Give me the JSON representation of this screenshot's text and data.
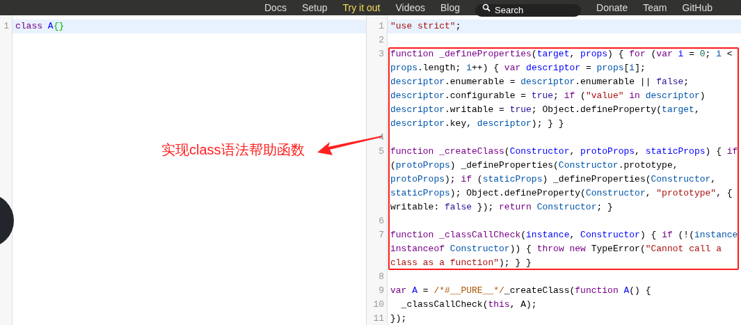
{
  "nav": {
    "items": [
      {
        "label": "Docs",
        "selected": false
      },
      {
        "label": "Setup",
        "selected": false
      },
      {
        "label": "Try it out",
        "selected": true
      },
      {
        "label": "Videos",
        "selected": false
      },
      {
        "label": "Blog",
        "selected": false
      }
    ],
    "search": {
      "placeholder": "Search"
    },
    "items_right": [
      {
        "label": "Donate",
        "selected": false
      },
      {
        "label": "Team",
        "selected": false
      },
      {
        "label": "GitHub",
        "selected": false
      }
    ]
  },
  "input_editor": {
    "lines": [
      {
        "number": "1",
        "selected": true,
        "tokens": [
          {
            "kind": "kw",
            "text": "class "
          },
          {
            "kind": "def",
            "text": "A"
          },
          {
            "kind": "br",
            "text": "{}"
          }
        ]
      }
    ]
  },
  "output_editor": {
    "lines_before": [
      {
        "number": "1",
        "selected": true,
        "tokens": [
          {
            "kind": "str",
            "text": "\"use strict\""
          },
          {
            "kind": "p",
            "text": ";"
          }
        ]
      },
      {
        "number": "2",
        "selected": false
      }
    ],
    "highlight_box": {
      "lines": [
        {
          "number": "3",
          "selected": false,
          "tokens": [
            {
              "kind": "kw",
              "text": "function _defineProperties"
            },
            {
              "kind": "p",
              "text": "("
            },
            {
              "kind": "def",
              "text": "target"
            },
            {
              "kind": "p",
              "text": ", "
            },
            {
              "kind": "def",
              "text": "props"
            },
            {
              "kind": "p",
              "text": ") { "
            },
            {
              "kind": "kw",
              "text": "for"
            },
            {
              "kind": "p",
              "text": " ("
            },
            {
              "kind": "kw",
              "text": "var "
            },
            {
              "kind": "def",
              "text": "i"
            },
            {
              "kind": "p",
              "text": " = "
            },
            {
              "kind": "num",
              "text": "0"
            },
            {
              "kind": "p",
              "text": "; "
            },
            {
              "kind": "v",
              "text": "i"
            },
            {
              "kind": "p",
              "text": " < "
            },
            {
              "kind": "v",
              "text": "props"
            },
            {
              "kind": "p",
              "text": ".length; "
            },
            {
              "kind": "v",
              "text": "i"
            },
            {
              "kind": "p",
              "text": "++) { "
            },
            {
              "kind": "kw",
              "text": "var "
            },
            {
              "kind": "def",
              "text": "descriptor"
            },
            {
              "kind": "p",
              "text": " = "
            },
            {
              "kind": "v",
              "text": "props"
            },
            {
              "kind": "p",
              "text": "["
            },
            {
              "kind": "v",
              "text": "i"
            },
            {
              "kind": "p",
              "text": "]; "
            },
            {
              "kind": "v",
              "text": "descriptor"
            },
            {
              "kind": "p",
              "text": ".enumerable = "
            },
            {
              "kind": "v",
              "text": "descriptor"
            },
            {
              "kind": "p",
              "text": ".enumerable || "
            },
            {
              "kind": "atom",
              "text": "false"
            },
            {
              "kind": "p",
              "text": "; "
            },
            {
              "kind": "v",
              "text": "descriptor"
            },
            {
              "kind": "p",
              "text": ".configurable = "
            },
            {
              "kind": "atom",
              "text": "true"
            },
            {
              "kind": "p",
              "text": "; "
            },
            {
              "kind": "kw",
              "text": "if"
            },
            {
              "kind": "p",
              "text": " ("
            },
            {
              "kind": "str",
              "text": "\"value\""
            },
            {
              "kind": "kw",
              "text": " in "
            },
            {
              "kind": "v",
              "text": "descriptor"
            },
            {
              "kind": "p",
              "text": ") "
            },
            {
              "kind": "v",
              "text": "descriptor"
            },
            {
              "kind": "p",
              "text": ".writable = "
            },
            {
              "kind": "atom",
              "text": "true"
            },
            {
              "kind": "p",
              "text": "; Object.defineProperty("
            },
            {
              "kind": "v",
              "text": "target"
            },
            {
              "kind": "p",
              "text": ", "
            },
            {
              "kind": "v",
              "text": "descriptor"
            },
            {
              "kind": "p",
              "text": ".key, "
            },
            {
              "kind": "v",
              "text": "descriptor"
            },
            {
              "kind": "p",
              "text": "); } }"
            }
          ]
        },
        {
          "number": "4",
          "selected": false
        },
        {
          "number": "5",
          "selected": false,
          "tokens": [
            {
              "kind": "kw",
              "text": "function _createClass"
            },
            {
              "kind": "p",
              "text": "("
            },
            {
              "kind": "def",
              "text": "Constructor"
            },
            {
              "kind": "p",
              "text": ", "
            },
            {
              "kind": "def",
              "text": "protoProps"
            },
            {
              "kind": "p",
              "text": ", "
            },
            {
              "kind": "def",
              "text": "staticProps"
            },
            {
              "kind": "p",
              "text": ") { "
            },
            {
              "kind": "kw",
              "text": "if"
            },
            {
              "kind": "p",
              "text": " ("
            },
            {
              "kind": "v",
              "text": "protoProps"
            },
            {
              "kind": "p",
              "text": ") _defineProperties("
            },
            {
              "kind": "v",
              "text": "Constructor"
            },
            {
              "kind": "p",
              "text": ".prototype, "
            },
            {
              "kind": "v",
              "text": "protoProps"
            },
            {
              "kind": "p",
              "text": "); "
            },
            {
              "kind": "kw",
              "text": "if"
            },
            {
              "kind": "p",
              "text": " ("
            },
            {
              "kind": "v",
              "text": "staticProps"
            },
            {
              "kind": "p",
              "text": ") _defineProperties("
            },
            {
              "kind": "v",
              "text": "Constructor"
            },
            {
              "kind": "p",
              "text": ", "
            },
            {
              "kind": "v",
              "text": "staticProps"
            },
            {
              "kind": "p",
              "text": "); Object.defineProperty("
            },
            {
              "kind": "v",
              "text": "Constructor"
            },
            {
              "kind": "p",
              "text": ", "
            },
            {
              "kind": "str",
              "text": "\"prototype\""
            },
            {
              "kind": "p",
              "text": ", { writable: "
            },
            {
              "kind": "atom",
              "text": "false"
            },
            {
              "kind": "p",
              "text": " }); "
            },
            {
              "kind": "kw",
              "text": "return "
            },
            {
              "kind": "v",
              "text": "Constructor"
            },
            {
              "kind": "p",
              "text": "; }"
            }
          ]
        },
        {
          "number": "6",
          "selected": false
        },
        {
          "number": "7",
          "selected": false,
          "tokens": [
            {
              "kind": "kw",
              "text": "function _classCallCheck"
            },
            {
              "kind": "p",
              "text": "("
            },
            {
              "kind": "def",
              "text": "instance"
            },
            {
              "kind": "p",
              "text": ", "
            },
            {
              "kind": "def",
              "text": "Constructor"
            },
            {
              "kind": "p",
              "text": ") { "
            },
            {
              "kind": "kw",
              "text": "if"
            },
            {
              "kind": "p",
              "text": " (!("
            },
            {
              "kind": "v",
              "text": "instance"
            },
            {
              "kind": "kw",
              "text": " instanceof "
            },
            {
              "kind": "v",
              "text": "Constructor"
            },
            {
              "kind": "p",
              "text": ")) { "
            },
            {
              "kind": "kw",
              "text": "throw new"
            },
            {
              "kind": "p",
              "text": " TypeError("
            },
            {
              "kind": "str",
              "text": "\"Cannot call a class as a function\""
            },
            {
              "kind": "p",
              "text": "); } }"
            }
          ]
        }
      ]
    },
    "lines_after": [
      {
        "number": "8",
        "selected": false
      },
      {
        "number": "9",
        "selected": false,
        "tokens": [
          {
            "kind": "kw",
            "text": "var "
          },
          {
            "kind": "def",
            "text": "A"
          },
          {
            "kind": "p",
            "text": " = "
          },
          {
            "kind": "cmt",
            "text": "/*#__PURE__*/"
          },
          {
            "kind": "p",
            "text": "_createClass("
          },
          {
            "kind": "kw",
            "text": "function "
          },
          {
            "kind": "def",
            "text": "A"
          },
          {
            "kind": "p",
            "text": "() {"
          }
        ]
      },
      {
        "number": "10",
        "selected": false,
        "tokens": [
          {
            "kind": "p",
            "text": "  _classCallCheck("
          },
          {
            "kind": "kw",
            "text": "this"
          },
          {
            "kind": "p",
            "text": ", A);"
          }
        ]
      },
      {
        "number": "11",
        "selected": false,
        "tokens": [
          {
            "kind": "p",
            "text": "});"
          }
        ]
      }
    ]
  },
  "annotation": {
    "text": "实现class语法帮助函数"
  }
}
